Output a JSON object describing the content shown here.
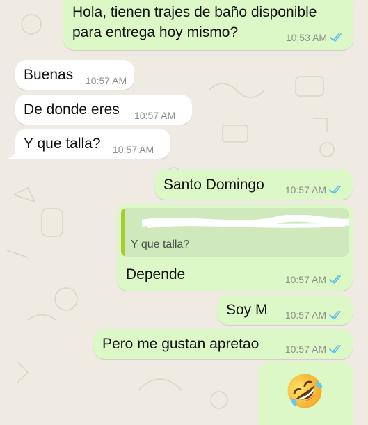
{
  "colors": {
    "background": "#efeae2",
    "incoming_bubble": "#ffffff",
    "outgoing_bubble": "#dcf8c6",
    "read_ticks": "#53bdeb",
    "quote_bar": "#a9cc2d"
  },
  "messages": [
    {
      "direction": "out",
      "lines": [
        "Hola, tienen trajes de baño disponible",
        "para entrega hoy mismo?"
      ],
      "time": "10:53 AM",
      "status": "read"
    },
    {
      "direction": "in",
      "text": "Buenas",
      "time": "10:57 AM"
    },
    {
      "direction": "in",
      "text": "De donde eres",
      "time": "10:57 AM"
    },
    {
      "direction": "in",
      "text": "Y que talla?",
      "time": "10:57 AM"
    },
    {
      "direction": "out",
      "text": "Santo Domingo",
      "time": "10:57 AM",
      "status": "read"
    },
    {
      "direction": "out",
      "quoted": "Y que talla?",
      "text": "Depende",
      "time": "10:57 AM",
      "status": "read"
    },
    {
      "direction": "out",
      "text": "Soy M",
      "time": "10:57 AM",
      "status": "read"
    },
    {
      "direction": "out",
      "text": "Pero me gustan apretao",
      "time": "10:57 AM",
      "status": "read"
    },
    {
      "direction": "out",
      "emoji": "🤣",
      "emoji_name": "rolling-on-floor-laughing-emoji"
    }
  ]
}
